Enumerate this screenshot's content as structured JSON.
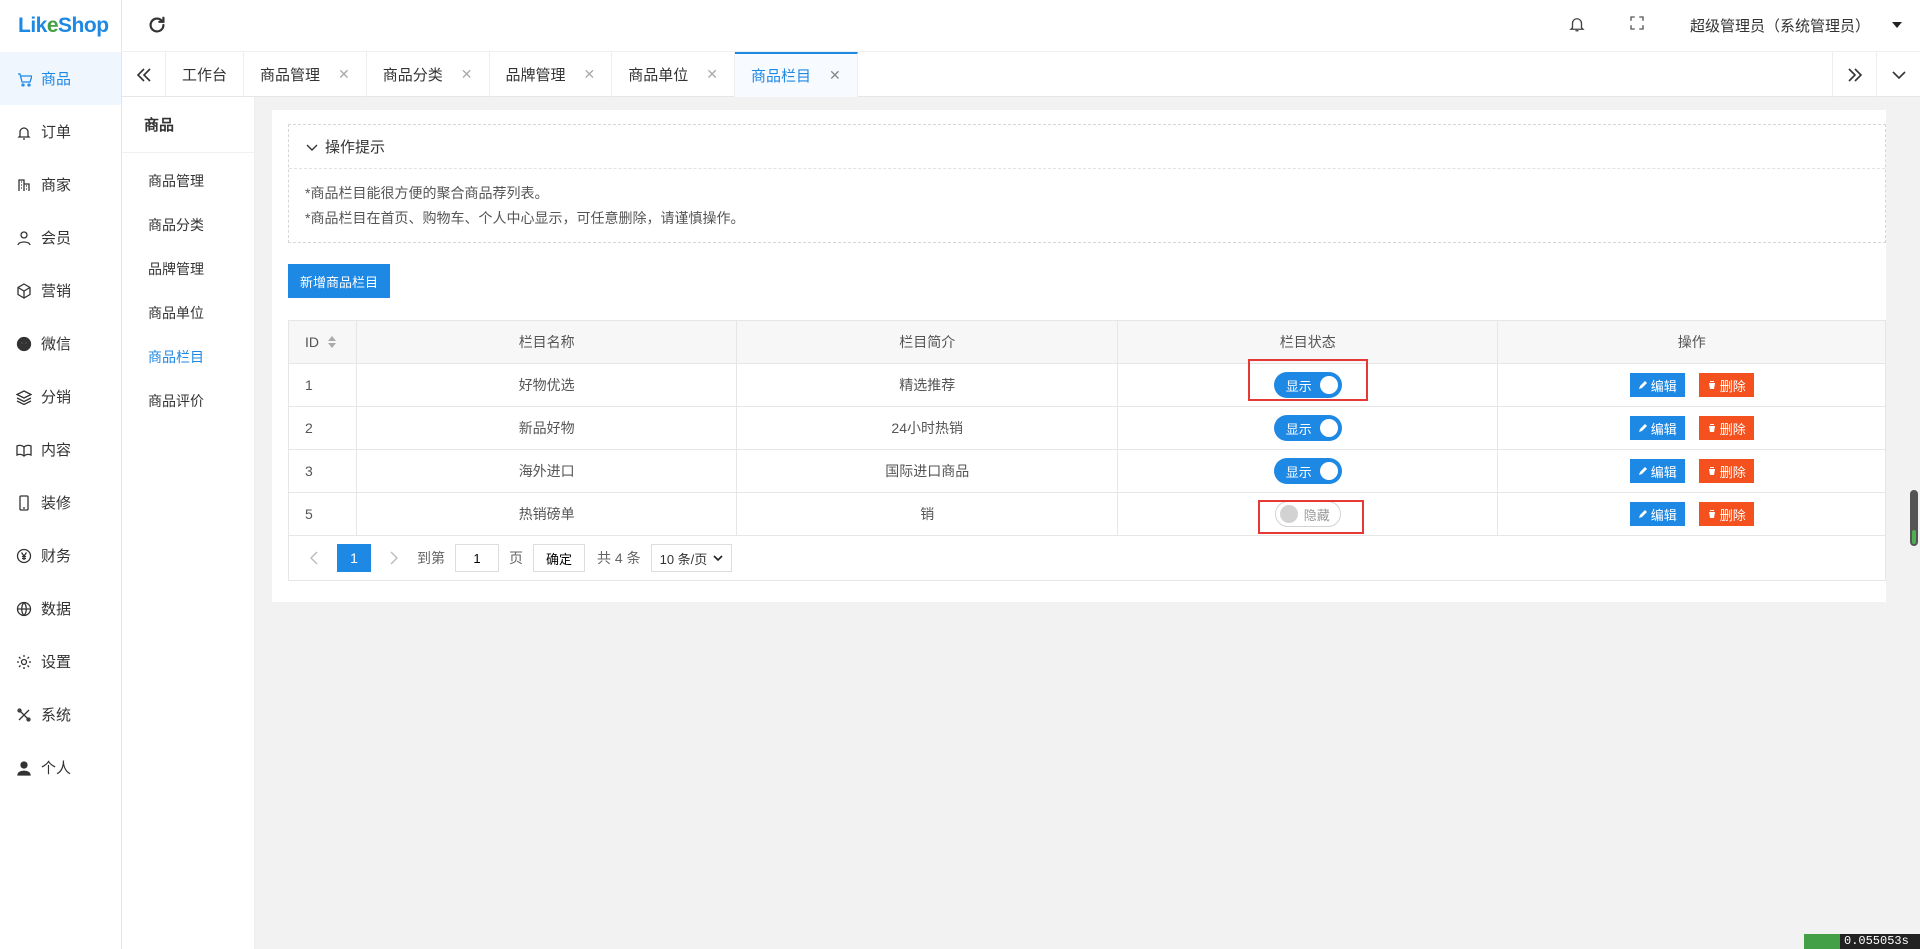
{
  "logo": {
    "text_a": "Lik",
    "text_b": "e",
    "text_c": "Shop"
  },
  "sidebar": {
    "items": [
      {
        "label": "商品",
        "icon": "cart-icon"
      },
      {
        "label": "订单",
        "icon": "bell-icon"
      },
      {
        "label": "商家",
        "icon": "building-icon"
      },
      {
        "label": "会员",
        "icon": "user-icon"
      },
      {
        "label": "营销",
        "icon": "cube-icon"
      },
      {
        "label": "微信",
        "icon": "wechat-icon"
      },
      {
        "label": "分销",
        "icon": "layers-icon"
      },
      {
        "label": "内容",
        "icon": "book-icon"
      },
      {
        "label": "装修",
        "icon": "phone-icon"
      },
      {
        "label": "财务",
        "icon": "yen-icon"
      },
      {
        "label": "数据",
        "icon": "globe-icon"
      },
      {
        "label": "设置",
        "icon": "gear-icon"
      },
      {
        "label": "系统",
        "icon": "tools-icon"
      },
      {
        "label": "个人",
        "icon": "person-icon"
      }
    ]
  },
  "header": {
    "user": "超级管理员（系统管理员）"
  },
  "tabs": [
    {
      "label": "工作台"
    },
    {
      "label": "商品管理"
    },
    {
      "label": "商品分类"
    },
    {
      "label": "品牌管理"
    },
    {
      "label": "商品单位"
    },
    {
      "label": "商品栏目"
    }
  ],
  "subside": {
    "title": "商品",
    "items": [
      "商品管理",
      "商品分类",
      "品牌管理",
      "商品单位",
      "商品栏目",
      "商品评价"
    ]
  },
  "tips": {
    "title": "操作提示",
    "line1": "*商品栏目能很方便的聚合商品荐列表。",
    "line2": "*商品栏目在首页、购物车、个人中心显示，可任意删除，请谨慎操作。"
  },
  "add_button": "新增商品栏目",
  "table": {
    "headers": {
      "id": "ID",
      "name": "栏目名称",
      "desc": "栏目简介",
      "status": "栏目状态",
      "op": "操作"
    },
    "rows": [
      {
        "id": "1",
        "name": "好物优选",
        "desc": "精选推荐",
        "status": "显示",
        "on": true
      },
      {
        "id": "2",
        "name": "新品好物",
        "desc": "24小时热销",
        "status": "显示",
        "on": true
      },
      {
        "id": "3",
        "name": "海外进口",
        "desc": "国际进口商品",
        "status": "显示",
        "on": true
      },
      {
        "id": "5",
        "name": "热销磅单",
        "desc": "销",
        "status": "隐藏",
        "on": false
      }
    ],
    "edit_label": "编辑",
    "delete_label": "删除"
  },
  "pager": {
    "current": "1",
    "goto_label": "到第",
    "goto_value": "1",
    "page_label": "页",
    "ok_label": "确定",
    "total": "共 4 条",
    "size": "10 条/页"
  },
  "corner_text": "0.055053s",
  "colors": {
    "primary": "#1e88e5",
    "danger": "#f4511e",
    "highlight": "#e53935"
  }
}
